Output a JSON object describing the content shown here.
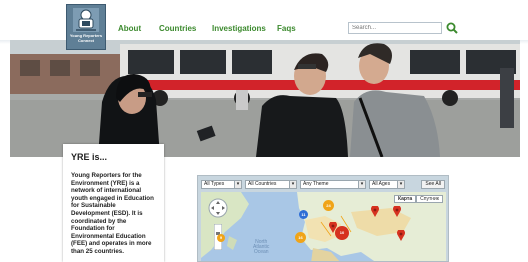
{
  "logo": {
    "alt": "Young Reporters Connect",
    "line1": "Young Reporters",
    "line2": "Connect"
  },
  "nav": {
    "items": [
      "About",
      "Countries",
      "Investigations",
      "Faqs"
    ]
  },
  "search": {
    "placeholder": "Search...",
    "icon": "search-icon"
  },
  "info": {
    "title": "YRE is...",
    "body": "Young Reporters for the Environment (YRE) is a network of international youth engaged in Education for Sustainable Development (ESD). It is coordinated by the Foundation for Environmental Education (FEE) and operates in more than 25 countries."
  },
  "map_widget": {
    "filters": [
      "All Types",
      "All Countries",
      "Any Theme",
      "All Ages"
    ],
    "see_all": "See All",
    "map_type_buttons": [
      "Карта",
      "Спутник"
    ],
    "ocean_label": [
      "North",
      "Atlantic",
      "Ocean"
    ],
    "clusters": [
      "11",
      "24",
      "16",
      "10",
      "9"
    ]
  },
  "colors": {
    "nav_green": "#3c8a2e",
    "logo_blue": "#5f7f96",
    "cluster_blue": "#2f6fd6",
    "cluster_orange": "#f0a418",
    "cluster_red": "#d6311f"
  }
}
